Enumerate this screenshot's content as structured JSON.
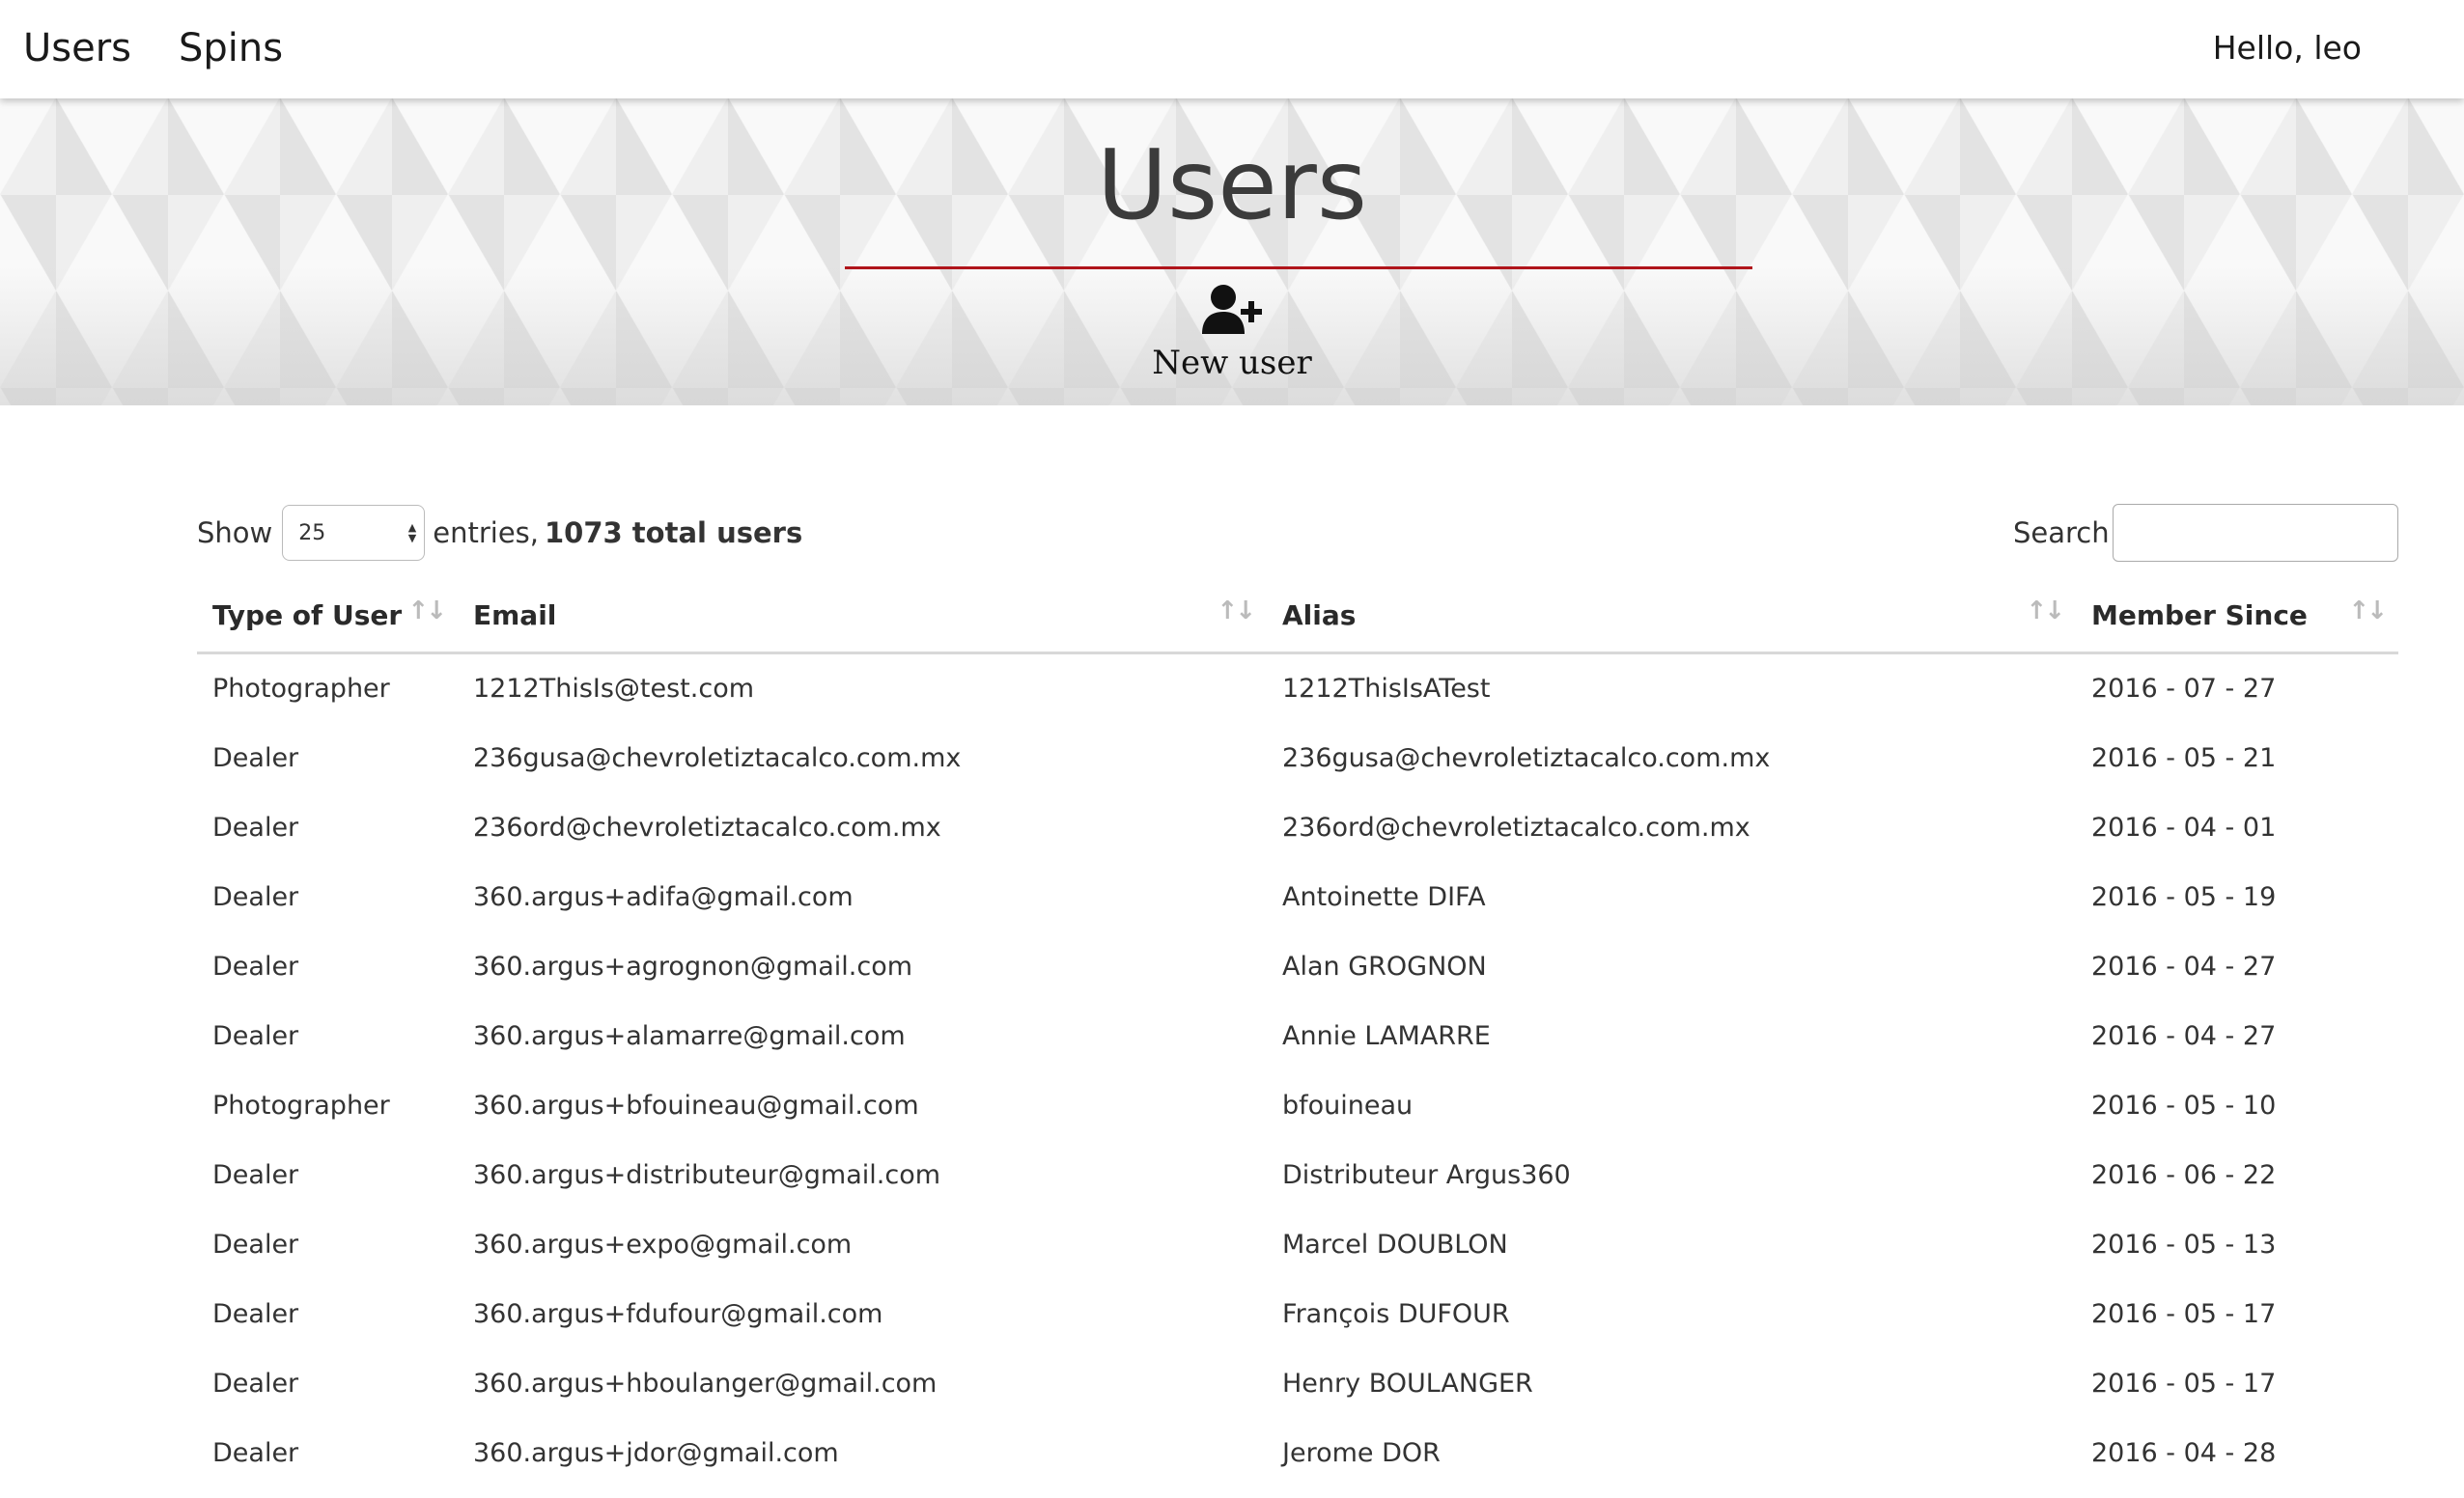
{
  "nav": {
    "links": [
      "Users",
      "Spins"
    ],
    "greeting": "Hello, leo"
  },
  "hero": {
    "title": "Users",
    "new_user_label": "New user",
    "accent_color": "#b0151b"
  },
  "controls": {
    "show_label": "Show",
    "entries_value": "25",
    "entries_label": "entries,",
    "total_label": "1073 total users",
    "search_label": "Search:",
    "search_value": ""
  },
  "table": {
    "columns": [
      "Type of User",
      "Email",
      "Alias",
      "Member Since"
    ],
    "rows": [
      [
        "Photographer",
        "1212ThisIs@test.com",
        "1212ThisIsATest",
        "2016 - 07 - 27"
      ],
      [
        "Dealer",
        "236gusa@chevroletiztacalco.com.mx",
        "236gusa@chevroletiztacalco.com.mx",
        "2016 - 05 - 21"
      ],
      [
        "Dealer",
        "236ord@chevroletiztacalco.com.mx",
        "236ord@chevroletiztacalco.com.mx",
        "2016 - 04 - 01"
      ],
      [
        "Dealer",
        "360.argus+adifa@gmail.com",
        "Antoinette DIFA",
        "2016 - 05 - 19"
      ],
      [
        "Dealer",
        "360.argus+agrognon@gmail.com",
        "Alan GROGNON",
        "2016 - 04 - 27"
      ],
      [
        "Dealer",
        "360.argus+alamarre@gmail.com",
        "Annie LAMARRE",
        "2016 - 04 - 27"
      ],
      [
        "Photographer",
        "360.argus+bfouineau@gmail.com",
        "bfouineau",
        "2016 - 05 - 10"
      ],
      [
        "Dealer",
        "360.argus+distributeur@gmail.com",
        "Distributeur Argus360",
        "2016 - 06 - 22"
      ],
      [
        "Dealer",
        "360.argus+expo@gmail.com",
        "Marcel DOUBLON",
        "2016 - 05 - 13"
      ],
      [
        "Dealer",
        "360.argus+fdufour@gmail.com",
        "François DUFOUR",
        "2016 - 05 - 17"
      ],
      [
        "Dealer",
        "360.argus+hboulanger@gmail.com",
        "Henry BOULANGER",
        "2016 - 05 - 17"
      ],
      [
        "Dealer",
        "360.argus+jdor@gmail.com",
        "Jerome DOR",
        "2016 - 04 - 28"
      ]
    ]
  }
}
